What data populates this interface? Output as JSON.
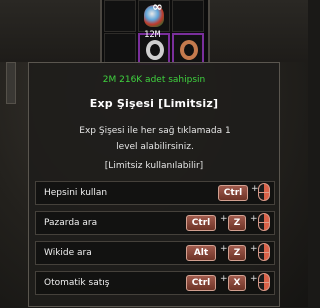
{
  "inventory": {
    "item_quantity": "12M",
    "infinity_symbol": "∞"
  },
  "tooltip": {
    "owned_text": "2M 216K adet sahipsin",
    "item_name": "Exp Şişesi [Limitsiz]",
    "description_line1": "Exp Şişesi ile her sağ tıklamada 1",
    "description_line2": "level alabilirsiniz.",
    "usage_note": "[Limitsiz kullanılabilir]",
    "actions": [
      {
        "label": "Hepsini kullan",
        "keys": [
          "Ctrl"
        ]
      },
      {
        "label": "Pazarda ara",
        "keys": [
          "Ctrl",
          "Z"
        ]
      },
      {
        "label": "Wikide ara",
        "keys": [
          "Alt",
          "Z"
        ]
      },
      {
        "label": "Otomatik satış",
        "keys": [
          "Ctrl",
          "X"
        ]
      }
    ],
    "plus_sign": "+",
    "colors": {
      "owned_text": "#3fd23f",
      "key_bg": "#8a4739",
      "mouse_right": "#d96148"
    }
  }
}
